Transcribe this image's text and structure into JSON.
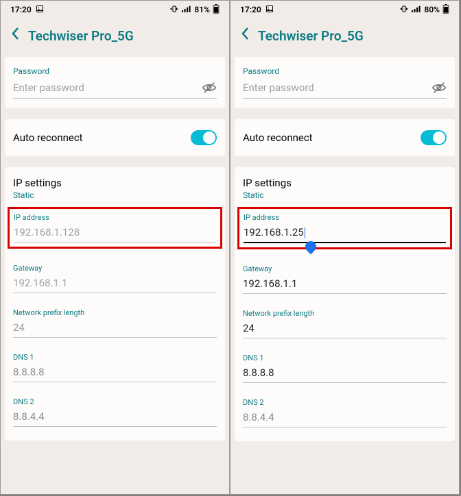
{
  "left": {
    "status": {
      "time": "17:20",
      "battery_text": "81%"
    },
    "header": {
      "title": "Techwiser Pro_5G"
    },
    "password": {
      "label": "Password",
      "placeholder": "Enter password"
    },
    "auto_reconnect": {
      "label": "Auto reconnect",
      "on": true
    },
    "ip": {
      "heading": "IP settings",
      "mode": "Static",
      "ip_label": "IP address",
      "ip_value": "192.168.1.128",
      "gateway_label": "Gateway",
      "gateway_value": "192.168.1.1",
      "prefix_label": "Network prefix length",
      "prefix_value": "24",
      "dns1_label": "DNS 1",
      "dns1_value": "8.8.8.8",
      "dns2_label": "DNS 2",
      "dns2_value": "8.8.4.4"
    }
  },
  "right": {
    "status": {
      "time": "17:20",
      "battery_text": "80%"
    },
    "header": {
      "title": "Techwiser Pro_5G"
    },
    "password": {
      "label": "Password",
      "placeholder": "Enter password"
    },
    "auto_reconnect": {
      "label": "Auto reconnect",
      "on": true
    },
    "ip": {
      "heading": "IP settings",
      "mode": "Static",
      "ip_label": "IP address",
      "ip_value": "192.168.1.25",
      "gateway_label": "Gateway",
      "gateway_value": "192.168.1.1",
      "prefix_label": "Network prefix length",
      "prefix_value": "24",
      "dns1_label": "DNS 1",
      "dns1_value": "8.8.8.8",
      "dns2_label": "DNS 2",
      "dns2_value": "8.8.4.4"
    }
  }
}
